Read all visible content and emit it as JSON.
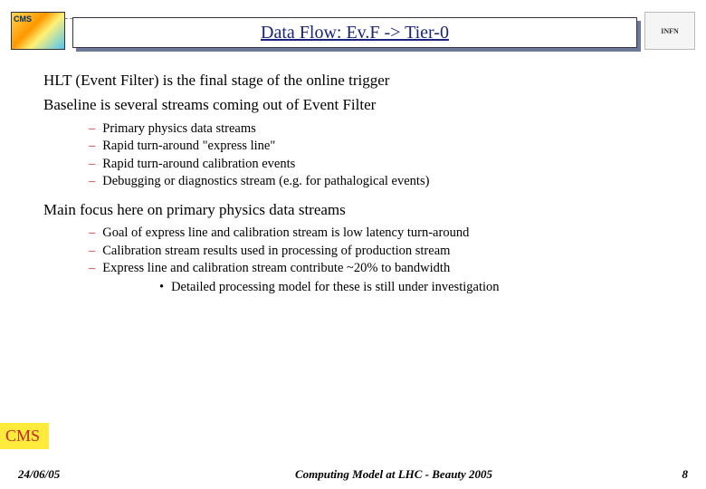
{
  "logo_left_text": "CMS",
  "logo_right_text": "INFN",
  "title": "Data Flow: Ev.F -> Tier-0",
  "bullets": {
    "b1": "HLT (Event Filter) is the final stage of the online trigger",
    "b2": "Baseline is several streams coming out of Event Filter",
    "b2_subs": {
      "s1": "Primary physics data streams",
      "s2": "Rapid turn-around \"express line\"",
      "s3": "Rapid turn-around calibration events",
      "s4": "Debugging or diagnostics stream (e.g. for pathalogical events)"
    },
    "b3": "Main focus here on primary physics data streams",
    "b3_subs": {
      "s1": "Goal of express line and calibration stream is low latency turn-around",
      "s2": "Calibration stream results used in processing of  production stream",
      "s3": "Express line and calibration stream contribute ~20% to bandwidth",
      "s3_sub": "Detailed processing model for these is still under investigation"
    }
  },
  "badge": "CMS",
  "footer": {
    "date": "24/06/05",
    "center": "Computing Model at LHC - Beauty 2005",
    "page": "8"
  }
}
